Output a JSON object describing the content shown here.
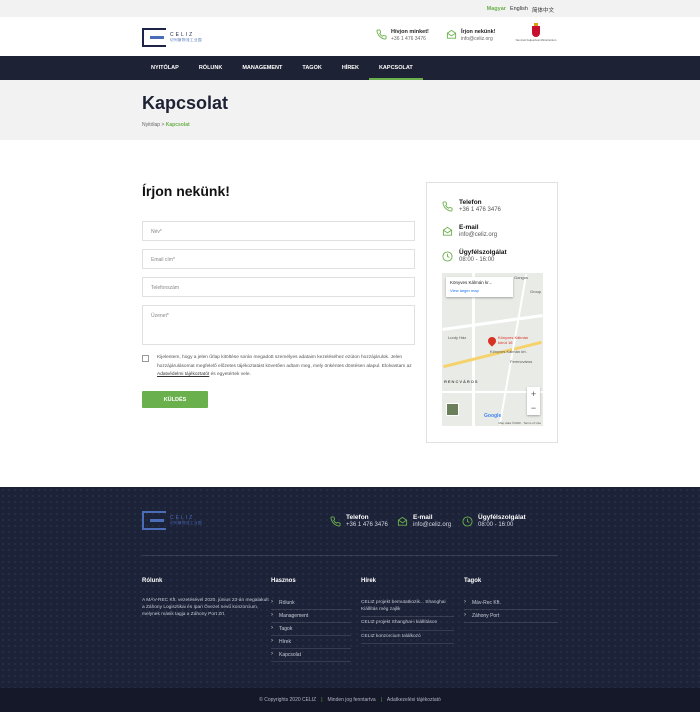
{
  "languages": {
    "active": "Magyar",
    "others": [
      "English",
      "简体中文"
    ]
  },
  "header": {
    "logo_text": "CELIZ",
    "logo_subtext": "切列斯物流工业园",
    "call": {
      "title": "Hívjon minket!",
      "value": "+36 1 476 3476"
    },
    "write": {
      "title": "Írjon nekünk!",
      "value": "info@celiz.org"
    },
    "gov_text": "Nemzeti Fejlesztési Minisztérium"
  },
  "nav": {
    "items": [
      "NYITÓLAP",
      "RÓLUNK",
      "MANAGEMENT",
      "TAGOK",
      "HÍREK",
      "KAPCSOLAT"
    ],
    "active_index": 5
  },
  "banner": {
    "title": "Kapcsolat",
    "crumb_home": "Nyitólap",
    "crumb_sep": ">",
    "crumb_current": "Kapcsolat"
  },
  "form": {
    "title": "Írjon nekünk!",
    "name_placeholder": "Név*",
    "email_placeholder": "Email cím*",
    "phone_placeholder": "Telefonszám",
    "message_placeholder": "Üzenet*",
    "consent_pre": "Kijelentem, hogy a jelen űrlap kitöltése során megadott személyes adataim kezeléséhez ezúton hozzájárulok. Jelen hozzájárulásomat megfelelő előzetes tájékoztatást követően adtam meg, mely önkéntes döntésen alapul. Elolvastam az ",
    "consent_link": "Adatvédelmi tájékoztatót",
    "consent_post": " és egyetértek vele.",
    "submit": "KÜLDÉS"
  },
  "sidebar": {
    "phone": {
      "title": "Telefon",
      "value": "+36 1 476 3476"
    },
    "email": {
      "title": "E-mail",
      "value": "info@celiz.org"
    },
    "service": {
      "title": "Ügyfélszolgálat",
      "value": "08:00 - 16:00"
    },
    "map": {
      "popup_title": "Könyves Kálmán kr...",
      "popup_link": "View larger map",
      "place_label": "Könyves Kálmán körút 16",
      "district": "RENCVÁROS",
      "label_a": "Lurdy Ház",
      "label_b": "Ferencváros",
      "label_c": "Group",
      "label_d": "Gongos",
      "label_e": "Könyves Kálmán krt.",
      "google": "Google",
      "terms": "Map data ©2020 · Terms of Use",
      "zoom_in": "+",
      "zoom_out": "−"
    }
  },
  "footer": {
    "phone": {
      "title": "Telefon",
      "value": "+36 1 476 3476"
    },
    "email": {
      "title": "E-mail",
      "value": "info@celiz.org"
    },
    "service": {
      "title": "Ügyfélszolgálat",
      "value": "08:00 - 16:00"
    },
    "about": {
      "title": "Rólunk",
      "text": "A MÁV-REC Kft. vezetésével 2020. június 23-án megalakult a Záhony Logisztikai és Ipari Övezet nevű konzorcium, melynek másik tagja a Záhony Port Zrt."
    },
    "useful": {
      "title": "Hasznos",
      "items": [
        "Rólunk",
        "Management",
        "Tagok",
        "Hírek",
        "Kapcsolat"
      ]
    },
    "news": {
      "title": "Hírek",
      "items": [
        "CELIZ projekt bemutatkozik... Shanghai Kiállítás még zajlik",
        "CELIZ projekt Shanghai-i kiállításon",
        "CELIZ konzorcium találkozó"
      ]
    },
    "members": {
      "title": "Tagok",
      "items": [
        "Máv-Rec Kft.",
        "Záhony Port"
      ]
    }
  },
  "bottom": {
    "copyright": "© Copyrights 2020 CELIZ",
    "rights": "Minden jog fenntartva",
    "privacy": "Adatkezelési tájékoztató"
  }
}
